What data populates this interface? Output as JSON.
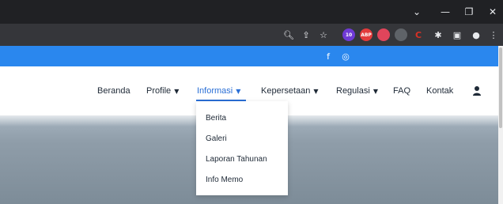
{
  "window_controls": {
    "dropdown_icon": "chevron-down-icon",
    "minimize_icon": "minimize-icon",
    "maximize_icon": "maximize-icon",
    "close_icon": "close-icon"
  },
  "browser_toolbar": {
    "icons": [
      "zoom-icon",
      "share-icon",
      "bookmark-star-icon"
    ],
    "extensions": [
      {
        "name": "extension-purple-icon",
        "badge": "10",
        "color": "#6f3ad6"
      },
      {
        "name": "extension-adblock-icon",
        "badge": "ABP",
        "color": "#e23b3b"
      },
      {
        "name": "extension-red-icon",
        "color": "#e0455b"
      },
      {
        "name": "extension-metamask-icon",
        "color": "#e27a25"
      },
      {
        "name": "extension-gray-icon",
        "color": "#5f6368"
      },
      {
        "name": "extension-c-icon",
        "color": "#d93025"
      }
    ],
    "right_icons": [
      "puzzle-icon",
      "sidepanel-icon",
      "profile-icon",
      "menu-icon"
    ]
  },
  "topbar": {
    "color": "#2a87ee",
    "social": [
      {
        "name": "facebook-icon",
        "glyph": "f"
      },
      {
        "name": "instagram-icon",
        "glyph": "◎"
      }
    ]
  },
  "nav": {
    "items": [
      {
        "label": "Beranda",
        "dropdown": false
      },
      {
        "label": "Profile",
        "dropdown": true
      },
      {
        "label": "Informasi",
        "dropdown": true,
        "active": true
      },
      {
        "label": "Kepersetaan",
        "dropdown": true
      },
      {
        "label": "Regulasi",
        "dropdown": true
      },
      {
        "label": "FAQ",
        "dropdown": false
      },
      {
        "label": "Kontak",
        "dropdown": false
      }
    ],
    "user_icon": "user-icon",
    "active_color": "#2a6fd6"
  },
  "dropdown": {
    "items": [
      "Berita",
      "Galeri",
      "Laporan Tahunan",
      "Info Memo"
    ]
  }
}
